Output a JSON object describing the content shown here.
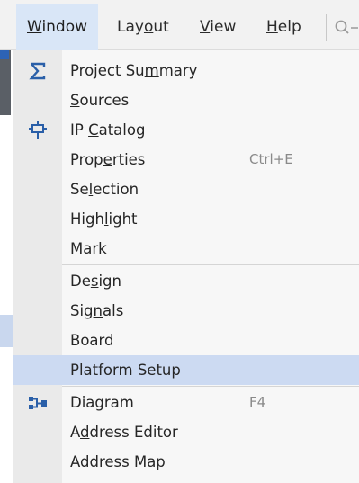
{
  "menubar": {
    "items": [
      {
        "label": "Window",
        "mnemonic_index": 0,
        "active": true
      },
      {
        "label": "Layout",
        "mnemonic_index": 3,
        "active": false
      },
      {
        "label": "View",
        "mnemonic_index": 0,
        "active": false
      },
      {
        "label": "Help",
        "mnemonic_index": 0,
        "active": false
      }
    ],
    "quick_search_icon": "search-icon"
  },
  "window_menu": {
    "groups": [
      {
        "items": [
          {
            "label": "Project Summary",
            "mnemonic_index": 10,
            "shortcut": "",
            "icon": "sigma-icon",
            "highlighted": false
          },
          {
            "label": "Sources",
            "mnemonic_index": 0,
            "shortcut": "",
            "icon": "",
            "highlighted": false
          },
          {
            "label": "IP Catalog",
            "mnemonic_index": 3,
            "shortcut": "",
            "icon": "ip-catalog-icon",
            "highlighted": false
          },
          {
            "label": "Properties",
            "mnemonic_index": 4,
            "shortcut": "Ctrl+E",
            "icon": "",
            "highlighted": false
          },
          {
            "label": "Selection",
            "mnemonic_index": 2,
            "shortcut": "",
            "icon": "",
            "highlighted": false
          },
          {
            "label": "Highlight",
            "mnemonic_index": 4,
            "shortcut": "",
            "icon": "",
            "highlighted": false
          },
          {
            "label": "Mark",
            "mnemonic_index": -1,
            "shortcut": "",
            "icon": "",
            "highlighted": false
          }
        ]
      },
      {
        "items": [
          {
            "label": "Design",
            "mnemonic_index": 2,
            "shortcut": "",
            "icon": "",
            "highlighted": false
          },
          {
            "label": "Signals",
            "mnemonic_index": 3,
            "shortcut": "",
            "icon": "",
            "highlighted": false
          },
          {
            "label": "Board",
            "mnemonic_index": -1,
            "shortcut": "",
            "icon": "",
            "highlighted": false
          },
          {
            "label": "Platform Setup",
            "mnemonic_index": -1,
            "shortcut": "",
            "icon": "",
            "highlighted": true
          }
        ]
      },
      {
        "items": [
          {
            "label": "Diagram",
            "mnemonic_index": -1,
            "shortcut": "F4",
            "icon": "diagram-icon",
            "highlighted": false
          },
          {
            "label": "Address Editor",
            "mnemonic_index": 1,
            "shortcut": "",
            "icon": "",
            "highlighted": false
          },
          {
            "label": "Address Map",
            "mnemonic_index": -1,
            "shortcut": "",
            "icon": "",
            "highlighted": false
          }
        ]
      }
    ]
  },
  "colors": {
    "menubar_bg": "#f2f2f2",
    "active_menu_bg": "#d9e6f7",
    "dropdown_bg": "#f7f7f7",
    "gutter_bg": "#eaeaea",
    "highlight_bg": "#ccdaf2",
    "text": "#262626",
    "shortcut_text": "#8a8a8a",
    "icon_blue": "#2a5fa8"
  }
}
